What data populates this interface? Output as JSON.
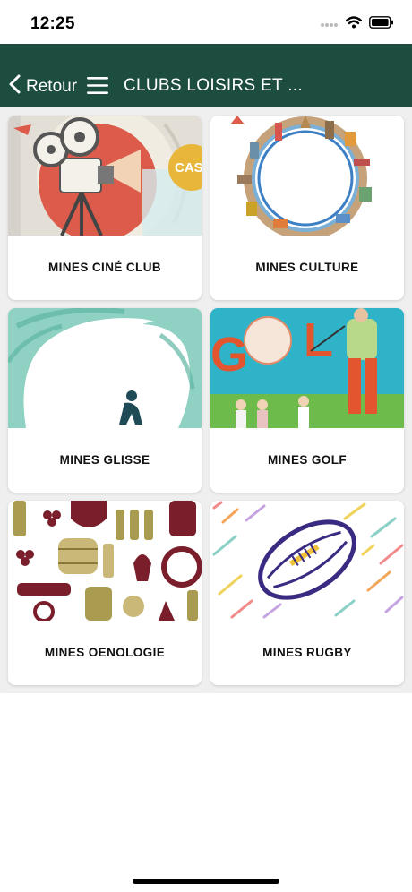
{
  "status_bar": {
    "time": "12:25"
  },
  "nav": {
    "back_label": "Retour",
    "title": "CLUBS LOISIRS ET ..."
  },
  "clubs": [
    {
      "name": "MINES CINÉ CLUB",
      "image": "cinema-projector-illustration"
    },
    {
      "name": "MINES CULTURE",
      "image": "world-landmarks-circle-illustration"
    },
    {
      "name": "MINES GLISSE",
      "image": "surfer-wave-illustration"
    },
    {
      "name": "MINES GOLF",
      "image": "golf-poster-illustration"
    },
    {
      "name": "MINES OENOLOGIE",
      "image": "wine-pattern-illustration"
    },
    {
      "name": "MINES RUGBY",
      "image": "rugby-ball-illustration"
    }
  ],
  "colors": {
    "nav_bar": "#1d4d3f",
    "background": "#efefef",
    "card": "#ffffff"
  }
}
